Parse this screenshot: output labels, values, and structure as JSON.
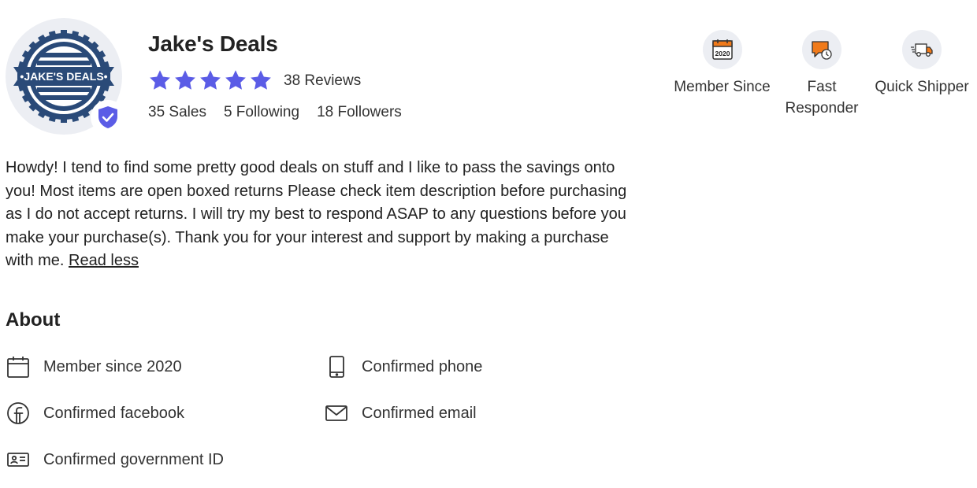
{
  "profile": {
    "name": "Jake's Deals",
    "avatar_text": "•JAKE'S DEALS•",
    "verified": true,
    "rating": 5,
    "reviews": "38 Reviews",
    "sales": "35 Sales",
    "following": "5 Following",
    "followers": "18 Followers"
  },
  "badges": [
    {
      "label": "Member Since",
      "icon": "calendar-2020-icon",
      "icon_text": "2020"
    },
    {
      "label": "Fast Responder",
      "icon": "fast-responder-icon"
    },
    {
      "label": "Quick Shipper",
      "icon": "delivery-truck-icon"
    }
  ],
  "bio": {
    "text": "Howdy! I tend to find some pretty good deals on stuff and I like to pass the savings onto you! Most items are open boxed returns Please check item description before purchasing as I do not accept returns. I will try my best to respond ASAP to any questions before you make your purchase(s). Thank you for your interest and support by making a purchase with me.",
    "toggle": "Read less"
  },
  "about": {
    "heading": "About",
    "items": [
      {
        "label": "Member since 2020",
        "icon": "calendar-icon"
      },
      {
        "label": "Confirmed phone",
        "icon": "phone-icon"
      },
      {
        "label": "Confirmed facebook",
        "icon": "facebook-icon"
      },
      {
        "label": "Confirmed email",
        "icon": "email-icon"
      },
      {
        "label": "Confirmed government ID",
        "icon": "id-card-icon"
      }
    ]
  },
  "colors": {
    "star": "#5b5ce6",
    "verified": "#5b5ce6",
    "badge_orange": "#f07a1a",
    "avatar_navy": "#2a4a78",
    "text": "#222222"
  }
}
